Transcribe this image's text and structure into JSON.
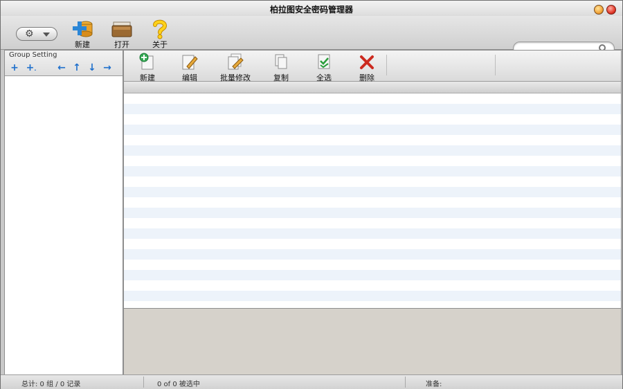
{
  "window": {
    "title": "柏拉图安全密码管理器"
  },
  "main_toolbar": {
    "items": [
      {
        "label": "新建",
        "icon": "new-database-icon"
      },
      {
        "label": "打开",
        "icon": "open-folder-icon"
      },
      {
        "label": "关于",
        "icon": "question-mark-icon"
      }
    ],
    "search": {
      "value": "",
      "placeholder": ""
    }
  },
  "left_panel": {
    "title": "Group Setting",
    "buttons": [
      "add-group",
      "add-subgroup",
      "move-left",
      "move-up",
      "move-down",
      "move-right"
    ]
  },
  "sub_toolbar": {
    "items": [
      {
        "label": "新建",
        "icon": "new-entry-icon"
      },
      {
        "label": "编辑",
        "icon": "edit-icon"
      },
      {
        "label": "批量修改",
        "icon": "batch-edit-icon"
      },
      {
        "label": "复制",
        "icon": "copy-icon"
      },
      {
        "label": "全选",
        "icon": "select-all-icon"
      },
      {
        "label": "删除",
        "icon": "delete-icon"
      }
    ]
  },
  "status": {
    "totals": "总计: 0 组 / 0 记录",
    "selection": "0 of 0 被选中",
    "ready": "准备:"
  },
  "colors": {
    "accent_blue": "#1e6fcc",
    "row_alt": "#edf3fa",
    "delete_red": "#cc2a1f"
  }
}
